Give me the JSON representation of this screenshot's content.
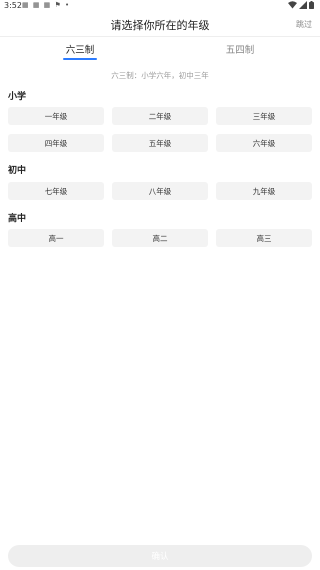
{
  "status_bar": {
    "time": "3:52",
    "notification_icons": "▦ ▦ ▦ ⚑ •",
    "wifi_icon": "wifi-icon",
    "signal_icon": "signal-icon",
    "battery_icon": "battery-icon"
  },
  "header": {
    "title": "请选择你所在的年级",
    "skip_label": "跳过"
  },
  "tabs": [
    {
      "label": "六三制",
      "active": true
    },
    {
      "label": "五四制",
      "active": false
    }
  ],
  "hint": "六三制：小学六年，初中三年",
  "sections": [
    {
      "title": "小学",
      "grades": [
        "一年级",
        "二年级",
        "三年级",
        "四年级",
        "五年级",
        "六年级"
      ]
    },
    {
      "title": "初中",
      "grades": [
        "七年级",
        "八年级",
        "九年级"
      ]
    },
    {
      "title": "高中",
      "grades": [
        "高一",
        "高二",
        "高三"
      ]
    }
  ],
  "confirm_label": "确认",
  "colors": {
    "accent": "#2b7bff",
    "button_bg": "#f3f3f3",
    "confirm_bg": "#eeeeee"
  }
}
